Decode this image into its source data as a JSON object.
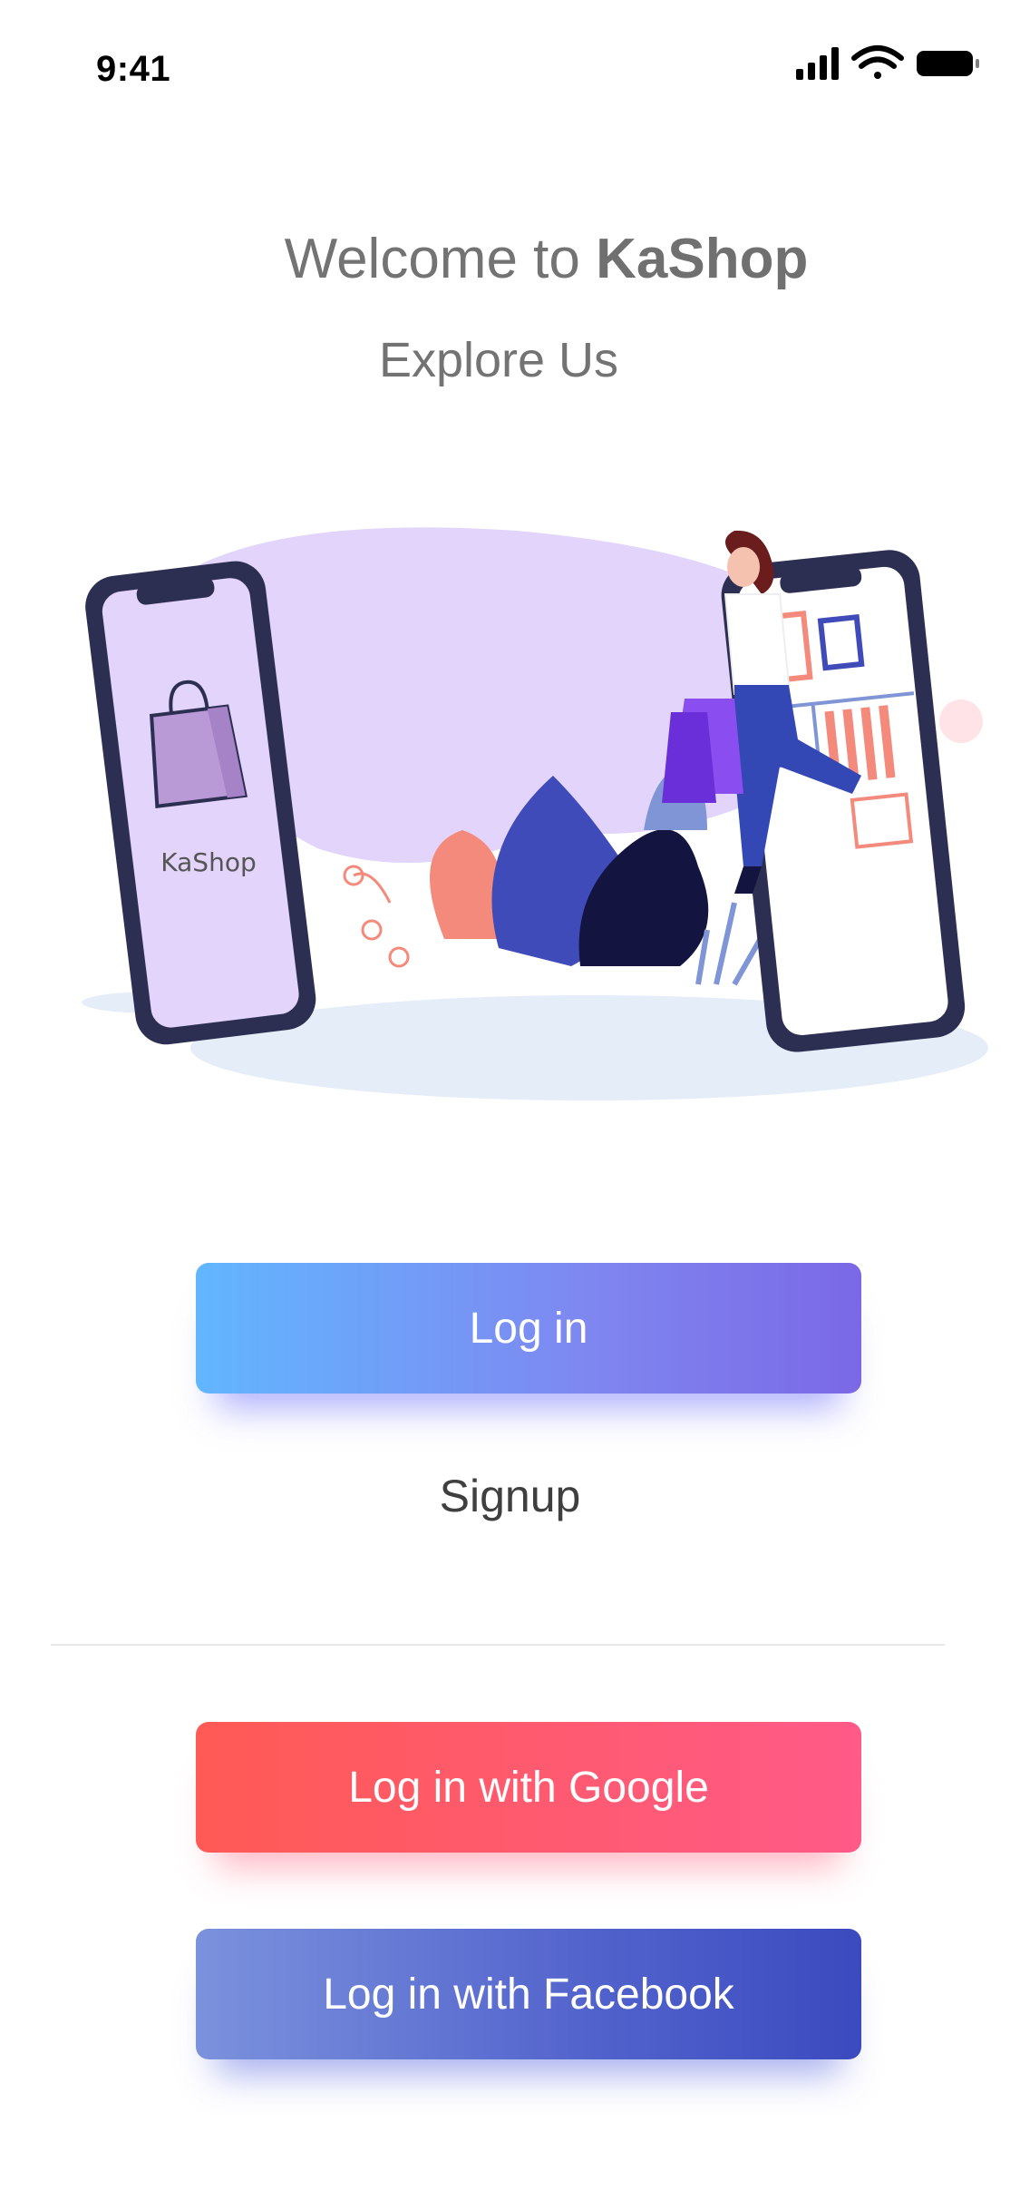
{
  "status_bar": {
    "time": "9:41"
  },
  "header": {
    "welcome_prefix": "Welcome to ",
    "brand": "KaShop",
    "subtitle": "Explore Us"
  },
  "illustration": {
    "phone_label": "KaShop"
  },
  "actions": {
    "login_label": "Log in",
    "signup_label": "Signup",
    "google_label": "Log in with Google",
    "facebook_label": "Log in with Facebook"
  },
  "colors": {
    "login_gradient": [
      "#62b6ff",
      "#7b68e6"
    ],
    "google_gradient": [
      "#ff5a55",
      "#ff5a88"
    ],
    "facebook_gradient": [
      "#7b92dd",
      "#3b4bbf"
    ],
    "illustration_purple": "#e2d4fb",
    "phone_frame": "#2d2f52"
  },
  "icons": [
    "cellular-signal-icon",
    "wifi-icon",
    "battery-icon",
    "shopping-bag-icon"
  ]
}
